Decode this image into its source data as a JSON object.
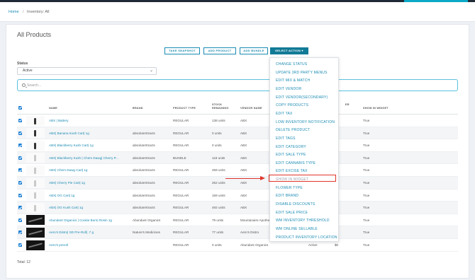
{
  "breadcrumb": {
    "home": "Home",
    "separator": "/",
    "current": "Inventory: All"
  },
  "page": {
    "title": "All Products",
    "total": "Total: 12"
  },
  "toolbar": {
    "take_snapshot": "TAKE SNAPSHOT",
    "add_product": "ADD PRODUCT",
    "add_bundle": "ADD BUNDLE",
    "select_action": "SELECT ACTION ▾"
  },
  "filters": {
    "status_label": "Status",
    "status_value": "Active",
    "search_placeholder": "Search..."
  },
  "table": {
    "headers": {
      "name": "NAME",
      "brand": "BRAND",
      "type": "PRODUCT TYPE",
      "stock": "STOCK REMAINING",
      "vendor": "VENDOR NAME",
      "price_partial": "ER",
      "widget": "SHOW IN WIDGET"
    },
    "rows": [
      {
        "name": "ABX | Battery",
        "brand": "",
        "type": "REGULAR",
        "stock": "138 units",
        "vendor": "ABX",
        "status": "",
        "price": "",
        "widget": "True",
        "thumb": "battery"
      },
      {
        "name": "ABX| Banana Kush Cart| 1g",
        "brand": "absoluteXtracts",
        "type": "REGULAR",
        "stock": "0 units",
        "vendor": "ABX",
        "status": "",
        "price": "",
        "widget": "True",
        "thumb": "cart"
      },
      {
        "name": "ABX| Blackberry Kush Cart| 1g",
        "brand": "absoluteXtracts",
        "type": "REGULAR",
        "stock": "0 units",
        "vendor": "ABX",
        "status": "",
        "price": "",
        "widget": "True",
        "thumb": "cart"
      },
      {
        "name": "ABX| Blackberry Kush | Chem Dawg| Cherry P...",
        "brand": "absoluteXtracts",
        "type": "BUNDLE",
        "stock": "119 units",
        "vendor": "ABX",
        "status": "",
        "price": "",
        "widget": "True",
        "thumb": "bundle"
      },
      {
        "name": "ABX| Chem Dawg Cart| 1g",
        "brand": "absoluteXtracts",
        "type": "REGULAR",
        "stock": "259 units",
        "vendor": "ABX",
        "status": "",
        "price": "",
        "widget": "True",
        "thumb": "cart-light"
      },
      {
        "name": "ABX| Cherry Pie Cart| 1g",
        "brand": "absoluteXtracts",
        "type": "REGULAR",
        "stock": "262 units",
        "vendor": "ABX",
        "status": "",
        "price": "",
        "widget": "True",
        "thumb": "cart-light"
      },
      {
        "name": "ABX| OG Cart| 1g",
        "brand": "absoluteXtracts",
        "type": "REGULAR",
        "stock": "159 units",
        "vendor": "ABX",
        "status": "",
        "price": "",
        "widget": "True",
        "thumb": "cart-light"
      },
      {
        "name": "ABX| OG Kush Cart| 1g",
        "brand": "absoluteXtracts",
        "type": "REGULAR",
        "stock": "492 units",
        "vendor": "ABX",
        "status": "",
        "price": "",
        "widget": "True",
        "thumb": "cart-light"
      },
      {
        "name": "Abundant Organics | Cookie Burn| Rosin 1g",
        "brand": "Abundant Organics",
        "type": "REGULAR",
        "stock": "79 units",
        "vendor": "Mountanaire Apothe...",
        "status": "",
        "price": "",
        "widget": "True",
        "thumb": "jar"
      },
      {
        "name": "Aero's Distro| SD Pre-Roll| .7 g",
        "brand": "Nature's Medicines",
        "type": "REGULAR",
        "stock": "77 units",
        "vendor": "Aero's Distro",
        "status": "",
        "price": "",
        "widget": "True",
        "thumb": "preroll"
      },
      {
        "name": "Aero's preroll",
        "brand": "",
        "type": "REGULAR",
        "stock": "0 units",
        "vendor": "Abundant Organics",
        "status": "Active",
        "price": "$0",
        "widget": "True",
        "thumb": "preroll"
      }
    ]
  },
  "action_menu": {
    "items": [
      "CHANGE STATUS",
      "UPDATE 3RD PARTY MENUS",
      "EDIT MIX & MATCH",
      "EDIT VENDOR",
      "EDIT VENDOR(SECONDARY)",
      "COPY PRODUCTS",
      "EDIT TAX",
      "LOW INVENTORY NOTIFICATION",
      "DELETE PRODUCT",
      "EDIT TAGS",
      "EDIT CATEGORY",
      "EDIT SALE TYPE",
      "EDIT CANNABIS TYPE",
      "EDIT EXCISE TAX",
      "SHOW IN WIDGET",
      "FLOWER TYPE",
      "EDIT BRAND",
      "DISABLE DISCOUNTS",
      "EDIT SALE PRICE",
      "WM INVENTORY THRESHOLD",
      "WM ONLINE SELLABLE",
      "PRODUCT INVENTORY LOCATION"
    ],
    "highlighted": "SHOW IN WIDGET"
  },
  "colors": {
    "accent": "#1a8bb3",
    "primary_button": "#117a96",
    "highlight": "#e0342a",
    "checkbox": "#1a7fd4"
  }
}
